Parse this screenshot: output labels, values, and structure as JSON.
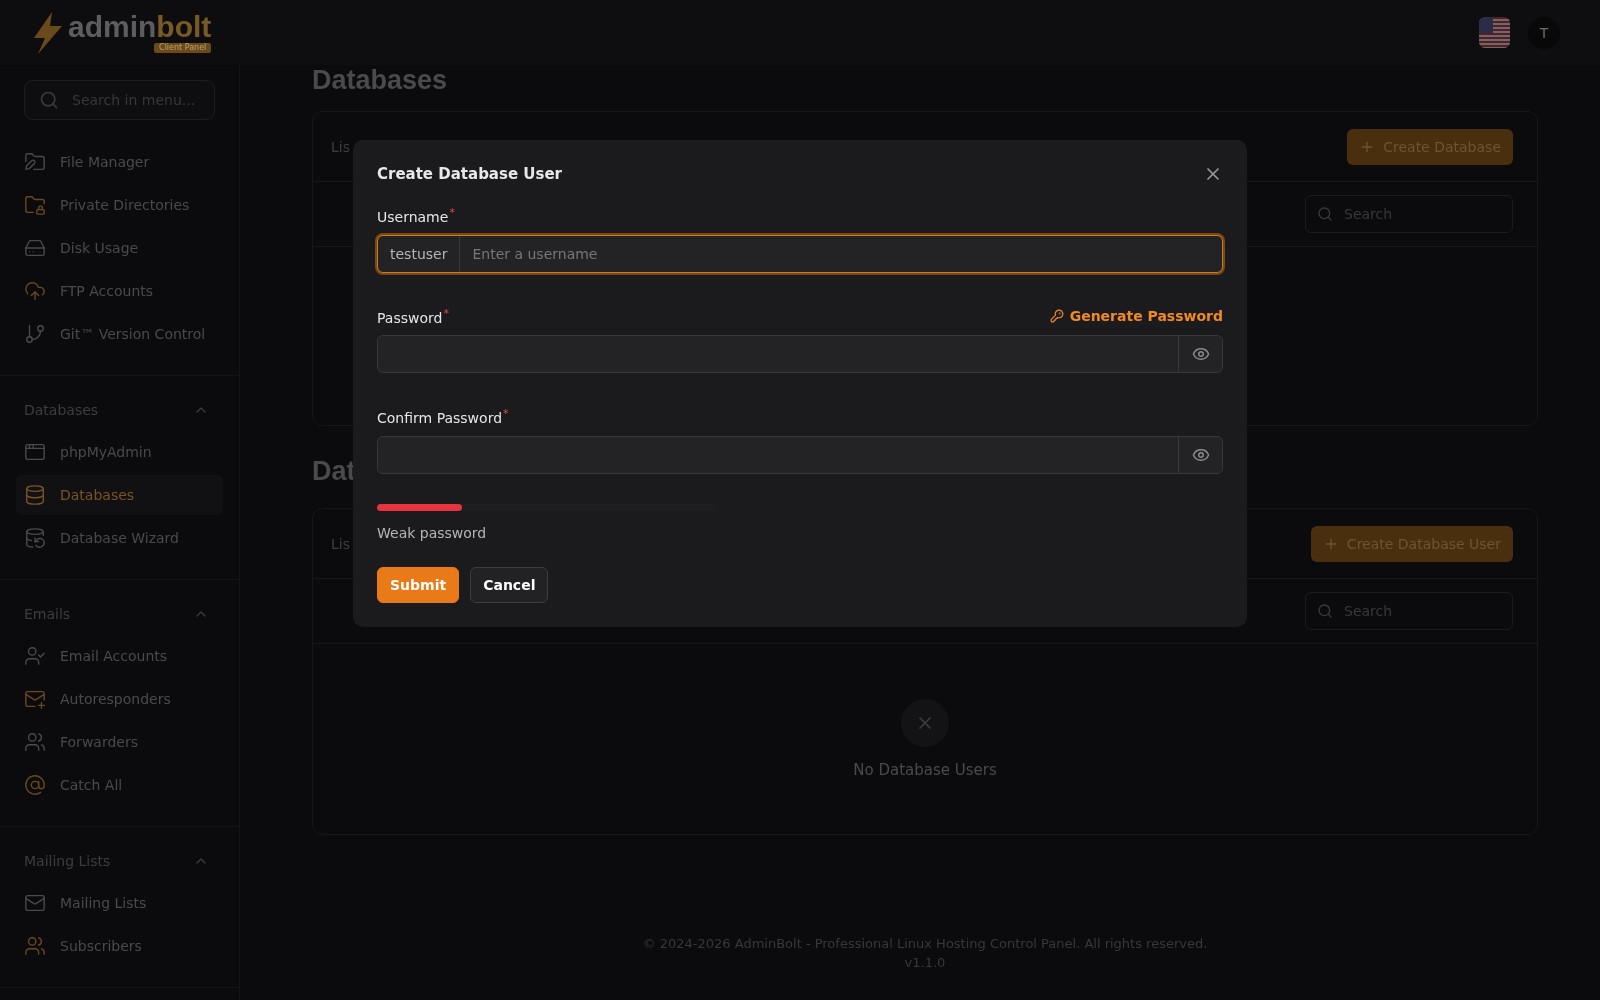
{
  "header": {
    "logo": {
      "word_1": "admin",
      "word_2": "bolt",
      "badge": "Client Panel"
    },
    "avatar": "T"
  },
  "sidebar": {
    "search": {
      "placeholder": "Search in menu..."
    },
    "sections": [
      {
        "items": [
          {
            "label": "File Manager",
            "selected": false
          },
          {
            "label": "Private Directories",
            "selected": false
          },
          {
            "label": "Disk Usage",
            "selected": false
          },
          {
            "label": "FTP Accounts",
            "selected": false
          },
          {
            "label": "Git™ Version Control",
            "selected": false
          }
        ]
      },
      {
        "title": "Databases",
        "expanded": true,
        "items": [
          {
            "label": "phpMyAdmin",
            "selected": false
          },
          {
            "label": "Databases",
            "selected": true
          },
          {
            "label": "Database Wizard",
            "selected": false
          }
        ]
      },
      {
        "title": "Emails",
        "expanded": true,
        "items": [
          {
            "label": "Email Accounts",
            "selected": false
          },
          {
            "label": "Autoresponders",
            "selected": false
          },
          {
            "label": "Forwarders",
            "selected": false
          },
          {
            "label": "Catch All",
            "selected": false
          }
        ]
      },
      {
        "title": "Mailing Lists",
        "expanded": true,
        "items": [
          {
            "label": "Mailing Lists",
            "selected": false
          },
          {
            "label": "Subscribers",
            "selected": false
          }
        ]
      }
    ]
  },
  "page": {
    "title": "Databases",
    "cards": [
      {
        "tab_label": "Lis",
        "button": "Create Database",
        "search": {
          "placeholder": "Search"
        }
      },
      {
        "heading": "Dat",
        "tab_label": "Lis",
        "button": "Create Database User",
        "search": {
          "placeholder": "Search"
        },
        "empty_message": "No Database Users"
      }
    ]
  },
  "modal": {
    "title": "Create Database User",
    "username": {
      "label": "Username",
      "required_mark": "*",
      "prefix": "testuser",
      "placeholder": "Enter a username",
      "focused": true
    },
    "password": {
      "label": "Password",
      "required_mark": "*",
      "generate_link": "Generate Password"
    },
    "confirm_password": {
      "label": "Confirm Password",
      "required_mark": "*"
    },
    "strength": {
      "level": 0.25,
      "label": "Weak password"
    },
    "buttons": [
      {
        "label": "Submit",
        "kind": "primary"
      },
      {
        "label": "Cancel",
        "kind": "secondary"
      }
    ]
  },
  "footer": {
    "copyright": "© 2024-2026 AdminBolt - Professional Linux Hosting Control Panel. All rights reserved.",
    "version": "v1.1.0"
  }
}
